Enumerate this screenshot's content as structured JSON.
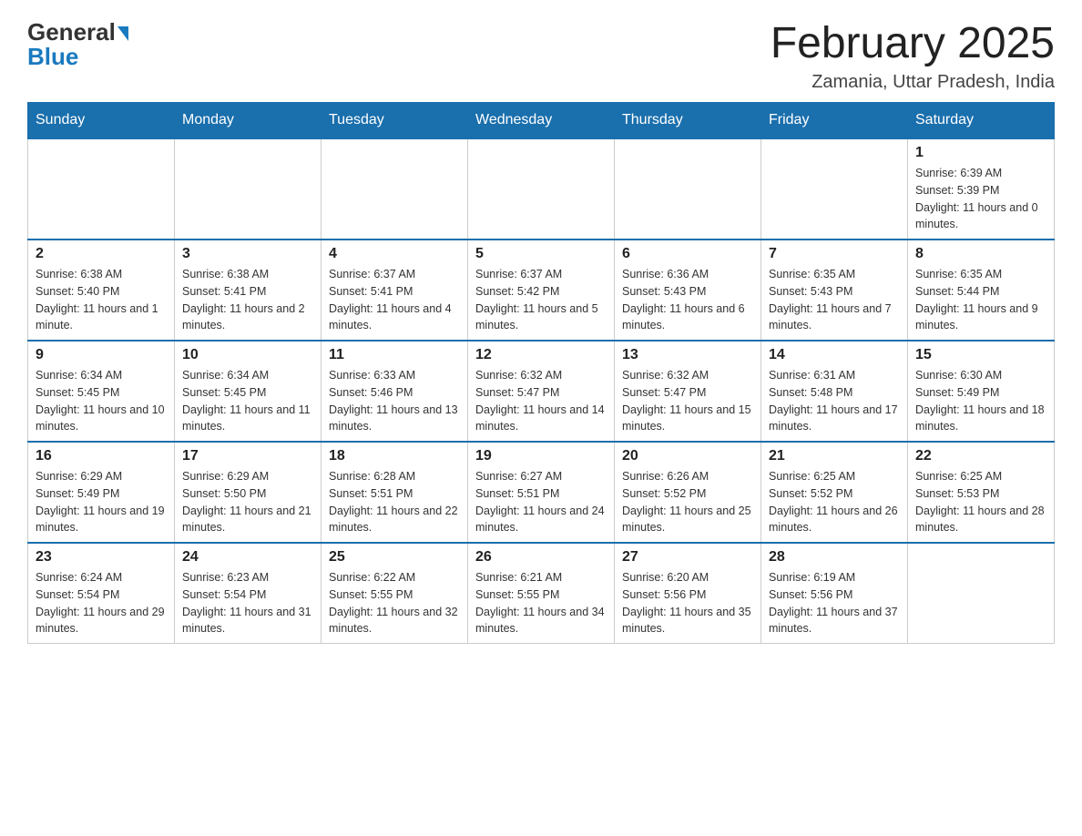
{
  "logo": {
    "general": "General",
    "blue": "Blue"
  },
  "header": {
    "title": "February 2025",
    "location": "Zamania, Uttar Pradesh, India"
  },
  "days": [
    "Sunday",
    "Monday",
    "Tuesday",
    "Wednesday",
    "Thursday",
    "Friday",
    "Saturday"
  ],
  "weeks": [
    [
      {
        "day": "",
        "info": ""
      },
      {
        "day": "",
        "info": ""
      },
      {
        "day": "",
        "info": ""
      },
      {
        "day": "",
        "info": ""
      },
      {
        "day": "",
        "info": ""
      },
      {
        "day": "",
        "info": ""
      },
      {
        "day": "1",
        "info": "Sunrise: 6:39 AM\nSunset: 5:39 PM\nDaylight: 11 hours and 0 minutes."
      }
    ],
    [
      {
        "day": "2",
        "info": "Sunrise: 6:38 AM\nSunset: 5:40 PM\nDaylight: 11 hours and 1 minute."
      },
      {
        "day": "3",
        "info": "Sunrise: 6:38 AM\nSunset: 5:41 PM\nDaylight: 11 hours and 2 minutes."
      },
      {
        "day": "4",
        "info": "Sunrise: 6:37 AM\nSunset: 5:41 PM\nDaylight: 11 hours and 4 minutes."
      },
      {
        "day": "5",
        "info": "Sunrise: 6:37 AM\nSunset: 5:42 PM\nDaylight: 11 hours and 5 minutes."
      },
      {
        "day": "6",
        "info": "Sunrise: 6:36 AM\nSunset: 5:43 PM\nDaylight: 11 hours and 6 minutes."
      },
      {
        "day": "7",
        "info": "Sunrise: 6:35 AM\nSunset: 5:43 PM\nDaylight: 11 hours and 7 minutes."
      },
      {
        "day": "8",
        "info": "Sunrise: 6:35 AM\nSunset: 5:44 PM\nDaylight: 11 hours and 9 minutes."
      }
    ],
    [
      {
        "day": "9",
        "info": "Sunrise: 6:34 AM\nSunset: 5:45 PM\nDaylight: 11 hours and 10 minutes."
      },
      {
        "day": "10",
        "info": "Sunrise: 6:34 AM\nSunset: 5:45 PM\nDaylight: 11 hours and 11 minutes."
      },
      {
        "day": "11",
        "info": "Sunrise: 6:33 AM\nSunset: 5:46 PM\nDaylight: 11 hours and 13 minutes."
      },
      {
        "day": "12",
        "info": "Sunrise: 6:32 AM\nSunset: 5:47 PM\nDaylight: 11 hours and 14 minutes."
      },
      {
        "day": "13",
        "info": "Sunrise: 6:32 AM\nSunset: 5:47 PM\nDaylight: 11 hours and 15 minutes."
      },
      {
        "day": "14",
        "info": "Sunrise: 6:31 AM\nSunset: 5:48 PM\nDaylight: 11 hours and 17 minutes."
      },
      {
        "day": "15",
        "info": "Sunrise: 6:30 AM\nSunset: 5:49 PM\nDaylight: 11 hours and 18 minutes."
      }
    ],
    [
      {
        "day": "16",
        "info": "Sunrise: 6:29 AM\nSunset: 5:49 PM\nDaylight: 11 hours and 19 minutes."
      },
      {
        "day": "17",
        "info": "Sunrise: 6:29 AM\nSunset: 5:50 PM\nDaylight: 11 hours and 21 minutes."
      },
      {
        "day": "18",
        "info": "Sunrise: 6:28 AM\nSunset: 5:51 PM\nDaylight: 11 hours and 22 minutes."
      },
      {
        "day": "19",
        "info": "Sunrise: 6:27 AM\nSunset: 5:51 PM\nDaylight: 11 hours and 24 minutes."
      },
      {
        "day": "20",
        "info": "Sunrise: 6:26 AM\nSunset: 5:52 PM\nDaylight: 11 hours and 25 minutes."
      },
      {
        "day": "21",
        "info": "Sunrise: 6:25 AM\nSunset: 5:52 PM\nDaylight: 11 hours and 26 minutes."
      },
      {
        "day": "22",
        "info": "Sunrise: 6:25 AM\nSunset: 5:53 PM\nDaylight: 11 hours and 28 minutes."
      }
    ],
    [
      {
        "day": "23",
        "info": "Sunrise: 6:24 AM\nSunset: 5:54 PM\nDaylight: 11 hours and 29 minutes."
      },
      {
        "day": "24",
        "info": "Sunrise: 6:23 AM\nSunset: 5:54 PM\nDaylight: 11 hours and 31 minutes."
      },
      {
        "day": "25",
        "info": "Sunrise: 6:22 AM\nSunset: 5:55 PM\nDaylight: 11 hours and 32 minutes."
      },
      {
        "day": "26",
        "info": "Sunrise: 6:21 AM\nSunset: 5:55 PM\nDaylight: 11 hours and 34 minutes."
      },
      {
        "day": "27",
        "info": "Sunrise: 6:20 AM\nSunset: 5:56 PM\nDaylight: 11 hours and 35 minutes."
      },
      {
        "day": "28",
        "info": "Sunrise: 6:19 AM\nSunset: 5:56 PM\nDaylight: 11 hours and 37 minutes."
      },
      {
        "day": "",
        "info": ""
      }
    ]
  ]
}
